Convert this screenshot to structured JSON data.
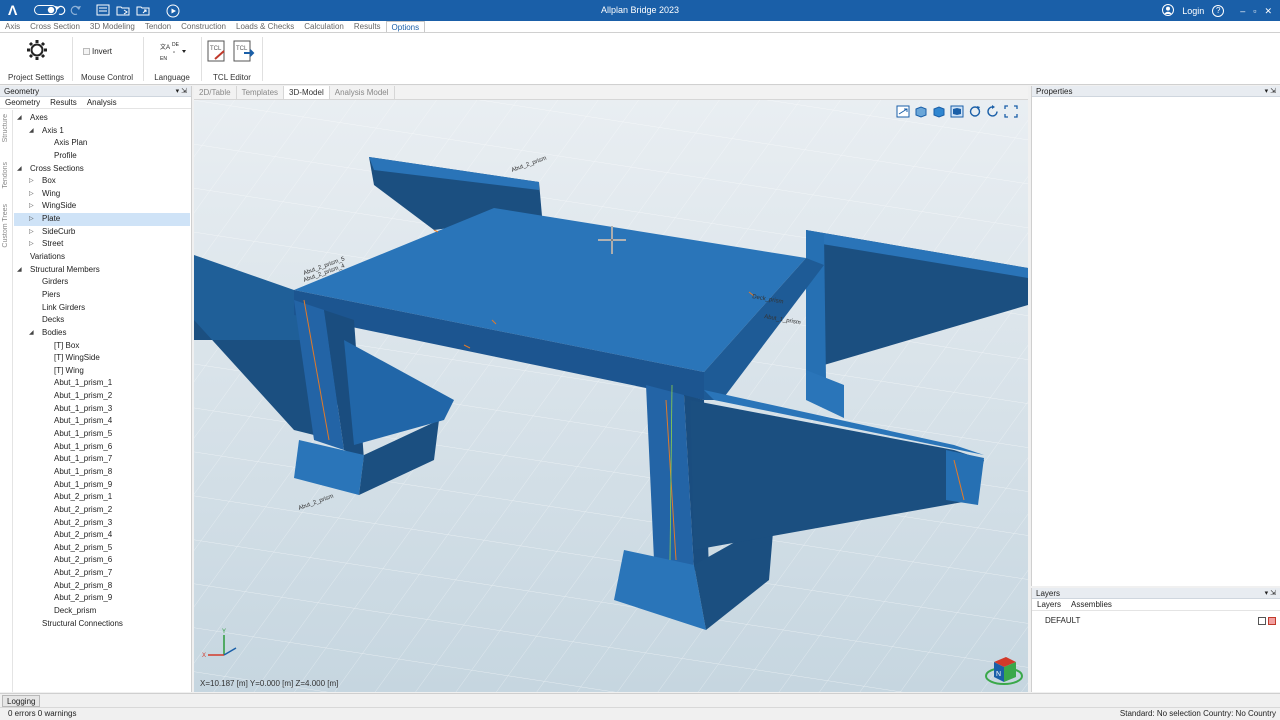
{
  "app": {
    "title": "Allplan Bridge 2023",
    "logo_glyph": "Λ",
    "login_label": "Login",
    "help_glyph": "?"
  },
  "menu": [
    {
      "label": "Axis",
      "active": false
    },
    {
      "label": "Cross Section",
      "active": false
    },
    {
      "label": "3D Modeling",
      "active": false
    },
    {
      "label": "Tendon",
      "active": false
    },
    {
      "label": "Construction",
      "active": false
    },
    {
      "label": "Loads & Checks",
      "active": false
    },
    {
      "label": "Calculation",
      "active": false
    },
    {
      "label": "Results",
      "active": false
    },
    {
      "label": "Options",
      "active": true
    }
  ],
  "ribbon": {
    "project_settings": "Project Settings",
    "invert": "Invert",
    "mouse_control": "Mouse Control",
    "language": "Language",
    "lang_de": "DE",
    "lang_en": "EN",
    "tcl_editor": "TCL Editor",
    "tcl_glyph": "TCL"
  },
  "left_panel": {
    "title": "Geometry",
    "tabs": [
      "Geometry",
      "Results",
      "Analysis"
    ],
    "vtabs": [
      "Structure",
      "Tendons",
      "Custom Trees"
    ],
    "tree": [
      {
        "label": "Axes",
        "level": 0,
        "arrow": "open"
      },
      {
        "label": "Axis 1",
        "level": 1,
        "arrow": "open"
      },
      {
        "label": "Axis Plan",
        "level": 2,
        "arrow": ""
      },
      {
        "label": "Profile",
        "level": 2,
        "arrow": ""
      },
      {
        "label": "Cross Sections",
        "level": 0,
        "arrow": "open"
      },
      {
        "label": "Box",
        "level": 1,
        "arrow": "closed"
      },
      {
        "label": "Wing",
        "level": 1,
        "arrow": "closed"
      },
      {
        "label": "WingSide",
        "level": 1,
        "arrow": "closed"
      },
      {
        "label": "Plate",
        "level": 1,
        "arrow": "closed",
        "selected": true
      },
      {
        "label": "SideCurb",
        "level": 1,
        "arrow": "closed"
      },
      {
        "label": "Street",
        "level": 1,
        "arrow": "closed"
      },
      {
        "label": "Variations",
        "level": 0,
        "arrow": ""
      },
      {
        "label": "Structural Members",
        "level": 0,
        "arrow": "open"
      },
      {
        "label": "Girders",
        "level": 1,
        "arrow": ""
      },
      {
        "label": "Piers",
        "level": 1,
        "arrow": ""
      },
      {
        "label": "Link Girders",
        "level": 1,
        "arrow": ""
      },
      {
        "label": "Decks",
        "level": 1,
        "arrow": ""
      },
      {
        "label": "Bodies",
        "level": 1,
        "arrow": "open"
      },
      {
        "label": "[T] Box",
        "level": 2,
        "arrow": ""
      },
      {
        "label": "[T] WingSide",
        "level": 2,
        "arrow": ""
      },
      {
        "label": "[T] Wing",
        "level": 2,
        "arrow": ""
      },
      {
        "label": "Abut_1_prism_1",
        "level": 2,
        "arrow": ""
      },
      {
        "label": "Abut_1_prism_2",
        "level": 2,
        "arrow": ""
      },
      {
        "label": "Abut_1_prism_3",
        "level": 2,
        "arrow": ""
      },
      {
        "label": "Abut_1_prism_4",
        "level": 2,
        "arrow": ""
      },
      {
        "label": "Abut_1_prism_5",
        "level": 2,
        "arrow": ""
      },
      {
        "label": "Abut_1_prism_6",
        "level": 2,
        "arrow": ""
      },
      {
        "label": "Abut_1_prism_7",
        "level": 2,
        "arrow": ""
      },
      {
        "label": "Abut_1_prism_8",
        "level": 2,
        "arrow": ""
      },
      {
        "label": "Abut_1_prism_9",
        "level": 2,
        "arrow": ""
      },
      {
        "label": "Abut_2_prism_1",
        "level": 2,
        "arrow": ""
      },
      {
        "label": "Abut_2_prism_2",
        "level": 2,
        "arrow": ""
      },
      {
        "label": "Abut_2_prism_3",
        "level": 2,
        "arrow": ""
      },
      {
        "label": "Abut_2_prism_4",
        "level": 2,
        "arrow": ""
      },
      {
        "label": "Abut_2_prism_5",
        "level": 2,
        "arrow": ""
      },
      {
        "label": "Abut_2_prism_6",
        "level": 2,
        "arrow": ""
      },
      {
        "label": "Abut_2_prism_7",
        "level": 2,
        "arrow": ""
      },
      {
        "label": "Abut_2_prism_8",
        "level": 2,
        "arrow": ""
      },
      {
        "label": "Abut_2_prism_9",
        "level": 2,
        "arrow": ""
      },
      {
        "label": "Deck_prism",
        "level": 2,
        "arrow": ""
      },
      {
        "label": "Structural Connections",
        "level": 1,
        "arrow": ""
      }
    ]
  },
  "view_tabs": [
    {
      "label": "2D/Table",
      "active": false
    },
    {
      "label": "Templates",
      "active": false
    },
    {
      "label": "3D-Model",
      "active": true
    },
    {
      "label": "Analysis Model",
      "active": false
    }
  ],
  "viewport": {
    "coord_readout": "X=10.187 [m] Y=0.000 [m] Z=4.000 [m]",
    "model_labels": {
      "abut_top_1": "Abut_2_prism_5",
      "abut_top_2": "Abut_2_prism_4",
      "deck": "Deck_prism",
      "abut1": "Abut_1_prism",
      "wing_far": "Abut_2_prism",
      "bottom_left": "Abut_2_prism"
    },
    "triad": {
      "y": "Y",
      "x": "X"
    },
    "navcube_label": "N",
    "tool_icons": [
      "zoom-extents-icon",
      "view-front-icon",
      "view-iso-icon",
      "view-top-icon",
      "refresh-icon",
      "rotate-icon",
      "fullscreen-icon"
    ]
  },
  "properties_panel": {
    "title": "Properties"
  },
  "layers_panel": {
    "title": "Layers",
    "tabs": [
      "Layers",
      "Assemblies"
    ],
    "rows": [
      {
        "name": "DEFAULT"
      }
    ]
  },
  "logging": {
    "tab": "Logging"
  },
  "status": {
    "left": "0 errors 0 warnings",
    "right": "Standard: No selection Country: No Country"
  },
  "colors": {
    "titlebar": "#1a5fa8",
    "model_blue": "#2670b3",
    "model_dark": "#1b4f80",
    "selection": "#cfe3f7"
  }
}
